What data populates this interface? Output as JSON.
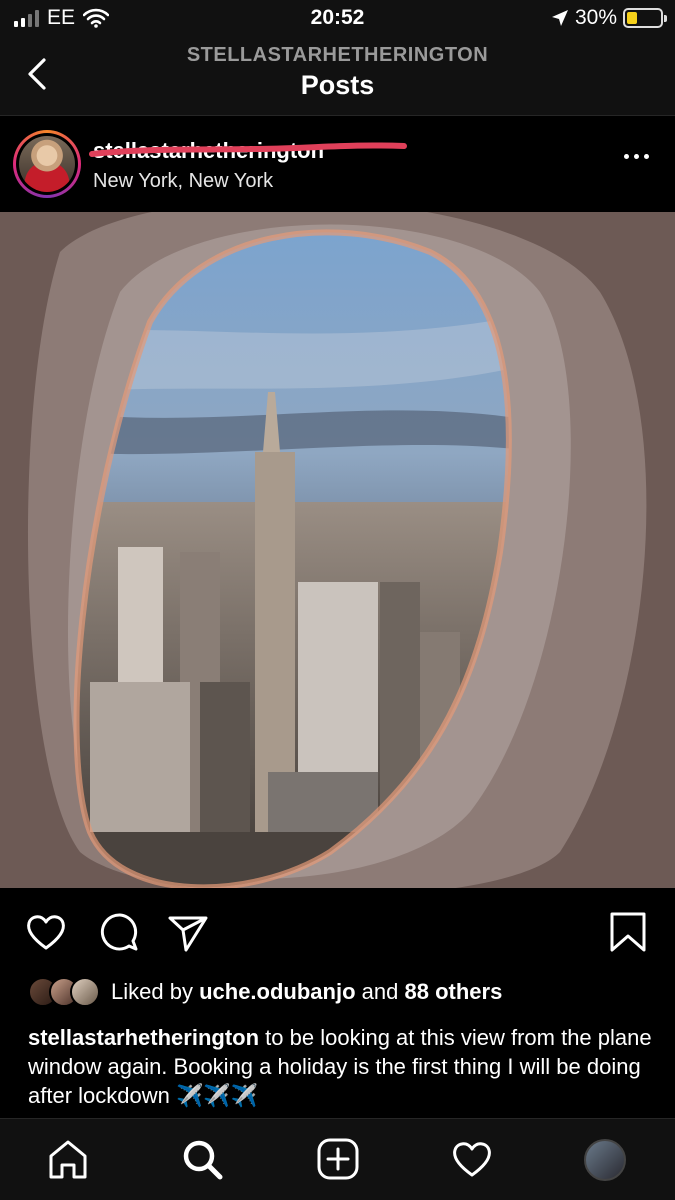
{
  "status_bar": {
    "carrier": "EE",
    "time": "20:52",
    "battery_percent": "30%",
    "battery_level": 0.3,
    "battery_color": "#f5d01a"
  },
  "header": {
    "subtitle": "STELLASTARHETHERINGTON",
    "title": "Posts",
    "back_icon": "chevron-left-icon"
  },
  "post": {
    "username": "stellastarhetherington",
    "location": "New York, New York",
    "more_icon": "more-horizontal-icon",
    "image_description_icon": "airplane-window-photo"
  },
  "actions": {
    "like_icon": "heart-icon",
    "comment_icon": "comment-icon",
    "share_icon": "send-icon",
    "save_icon": "bookmark-icon"
  },
  "likes": {
    "prefix": "Liked by",
    "user": "uche.odubanjo",
    "middle": "and",
    "others": "88 others"
  },
  "caption": {
    "username": "stellastarhetherington",
    "text": "to be looking at this view from the plane window again. Booking a holiday is the first thing I will be doing after lockdown ✈️✈️✈️"
  },
  "tabbar": {
    "items": [
      "home-icon",
      "search-icon",
      "new-post-icon",
      "activity-heart-icon",
      "profile-avatar"
    ]
  },
  "colors": {
    "background": "#000000",
    "bar": "#111111",
    "ring_gradient": [
      "#f58529",
      "#dd2a7b",
      "#8134af"
    ],
    "scribble": "#e0405a"
  }
}
